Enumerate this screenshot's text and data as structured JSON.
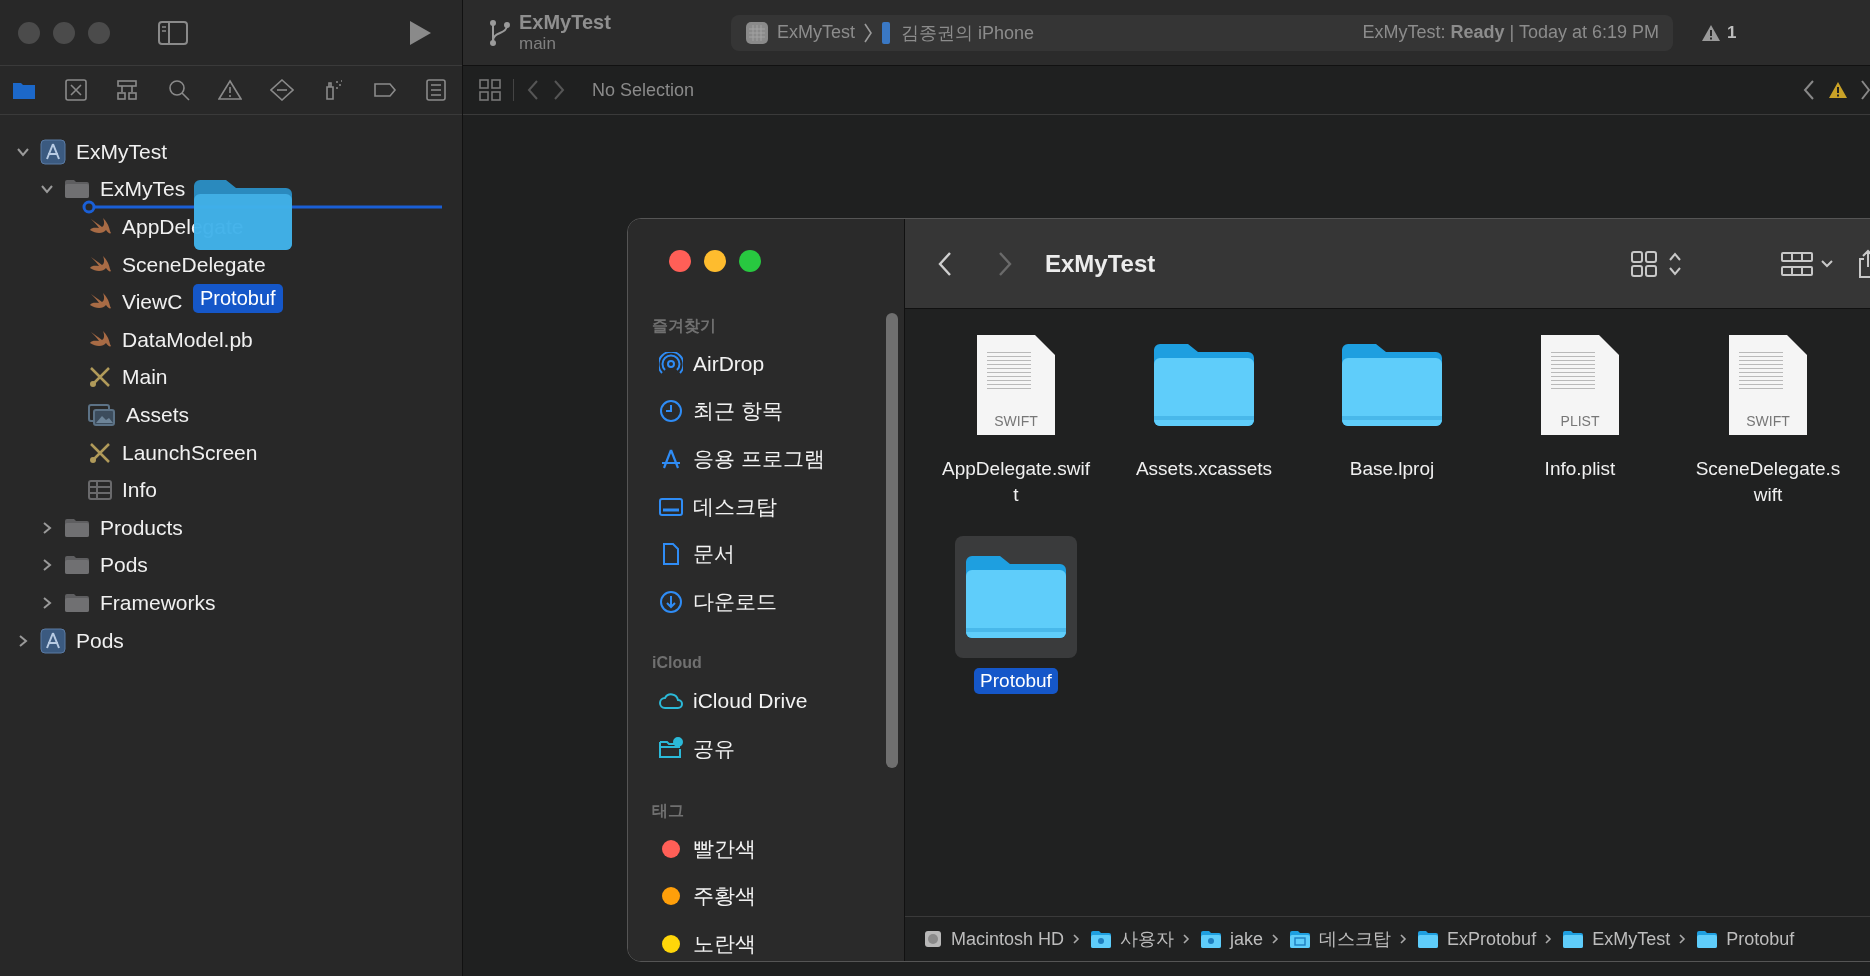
{
  "xcode": {
    "project_title": "ExMyTest",
    "branch": "main",
    "scheme": {
      "target": "ExMyTest",
      "device": "김종권의 iPhone",
      "status": "ExMyTest: **Ready** | Today at 6:19 PM"
    },
    "warning_count": "1",
    "jump_bar": "No Selection",
    "navigator_tabs": [
      {
        "kind": "folder",
        "selected": true
      },
      {
        "kind": "source-control",
        "selected": false
      },
      {
        "kind": "hierarchy",
        "selected": false
      },
      {
        "kind": "search",
        "selected": false
      },
      {
        "kind": "warning",
        "selected": false
      },
      {
        "kind": "test",
        "selected": false
      },
      {
        "kind": "debug",
        "selected": false
      },
      {
        "kind": "breakpoint",
        "selected": false
      },
      {
        "kind": "report",
        "selected": false
      }
    ],
    "tree": [
      {
        "label": "ExMyTest",
        "kind": "project",
        "expanded": true,
        "children": [
          {
            "label": "ExMyTes",
            "kind": "folder",
            "expanded": true,
            "children": [
              {
                "label": "AppDelegate",
                "kind": "swift"
              },
              {
                "label": "SceneDelegate",
                "kind": "swift"
              },
              {
                "label": "ViewC",
                "kind": "swift"
              },
              {
                "label": "DataModel.pb",
                "kind": "swift"
              },
              {
                "label": "Main",
                "kind": "storyboard"
              },
              {
                "label": "Assets",
                "kind": "assets"
              },
              {
                "label": "LaunchScreen",
                "kind": "storyboard"
              },
              {
                "label": "Info",
                "kind": "plist"
              }
            ]
          },
          {
            "label": "Products",
            "kind": "folder",
            "expanded": false
          },
          {
            "label": "Pods",
            "kind": "folder",
            "expanded": false
          },
          {
            "label": "Frameworks",
            "kind": "folder",
            "expanded": false
          }
        ]
      },
      {
        "label": "Pods",
        "kind": "project",
        "expanded": false
      }
    ],
    "drag": {
      "label": "Protobuf"
    }
  },
  "finder": {
    "title": "ExMyTest",
    "sidebar": [
      {
        "heading": "즐겨찾기",
        "items": [
          {
            "label": "AirDrop",
            "kind": "airdrop"
          },
          {
            "label": "최근 항목",
            "kind": "recent"
          },
          {
            "label": "응용 프로그램",
            "kind": "apps"
          },
          {
            "label": "데스크탑",
            "kind": "desktop"
          },
          {
            "label": "문서",
            "kind": "document"
          },
          {
            "label": "다운로드",
            "kind": "download"
          }
        ]
      },
      {
        "heading": "iCloud",
        "items": [
          {
            "label": "iCloud Drive",
            "kind": "cloud"
          },
          {
            "label": "공유",
            "kind": "shared"
          }
        ]
      },
      {
        "heading": "태그",
        "items": [
          {
            "label": "빨간색",
            "kind": "tag",
            "color": "#ff5f57"
          },
          {
            "label": "주황색",
            "kind": "tag",
            "color": "#ff9f0a"
          },
          {
            "label": "노란색",
            "kind": "tag",
            "color": "#ffd60a"
          }
        ]
      }
    ],
    "files": [
      {
        "name": "AppDelegate.swift",
        "kind": "document",
        "badge": "SWIFT",
        "selected": false
      },
      {
        "name": "Assets.xcassets",
        "kind": "folder",
        "selected": false
      },
      {
        "name": "Base.lproj",
        "kind": "folder",
        "selected": false
      },
      {
        "name": "Info.plist",
        "kind": "document",
        "badge": "PLIST",
        "selected": false
      },
      {
        "name": "SceneDelegate.swift",
        "kind": "document",
        "badge": "SWIFT",
        "selected": false
      },
      {
        "name": "Protobuf",
        "kind": "folder",
        "selected": true
      }
    ],
    "path": [
      {
        "label": "Macintosh HD",
        "kind": "disk"
      },
      {
        "label": "사용자",
        "kind": "users"
      },
      {
        "label": "jake",
        "kind": "home"
      },
      {
        "label": "데스크탑",
        "kind": "desktop"
      },
      {
        "label": "ExProtobuf",
        "kind": "folder"
      },
      {
        "label": "ExMyTest",
        "kind": "folder"
      },
      {
        "label": "Protobuf",
        "kind": "folder"
      }
    ]
  }
}
